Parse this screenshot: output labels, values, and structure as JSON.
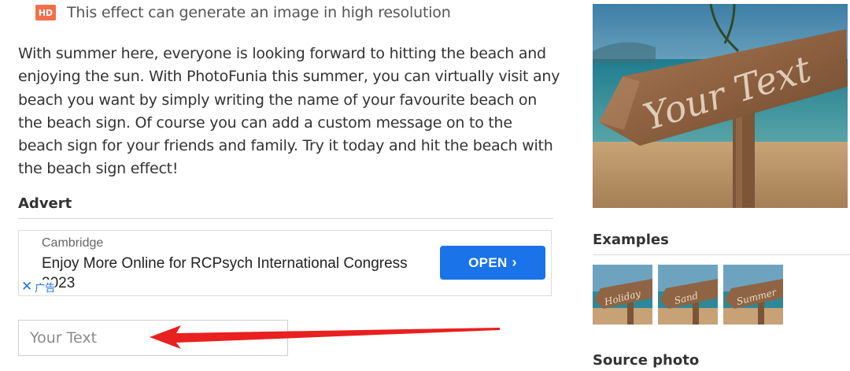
{
  "hd": {
    "badge": "HD",
    "text": "This effect can generate an image in high resolution"
  },
  "description": "With summer here, everyone is looking forward to hitting the beach and enjoying the sun. With PhotoFunia this summer, you can virtually visit any beach you want by simply writing the name of your favourite beach on the beach sign. Of course you can add a custom message on to the beach sign for your friends and family. Try it today and hit the beach with the beach sign effect!",
  "advert": {
    "title": "Advert",
    "sponsor": "Cambridge",
    "headline": "Enjoy More Online for RCPsych International Congress 2023",
    "open_label": "OPEN",
    "adchoice_label": "广告"
  },
  "input": {
    "placeholder": "Your Text"
  },
  "preview": {
    "sign_text": "Your Text"
  },
  "examples": {
    "title": "Examples",
    "items": [
      "Holiday",
      "Sand",
      "Summer"
    ]
  },
  "source_photo": {
    "title": "Source photo"
  },
  "colors": {
    "hd_badge": "#f36f4b",
    "open_button": "#1a73e8",
    "arrow": "#e8201f"
  }
}
